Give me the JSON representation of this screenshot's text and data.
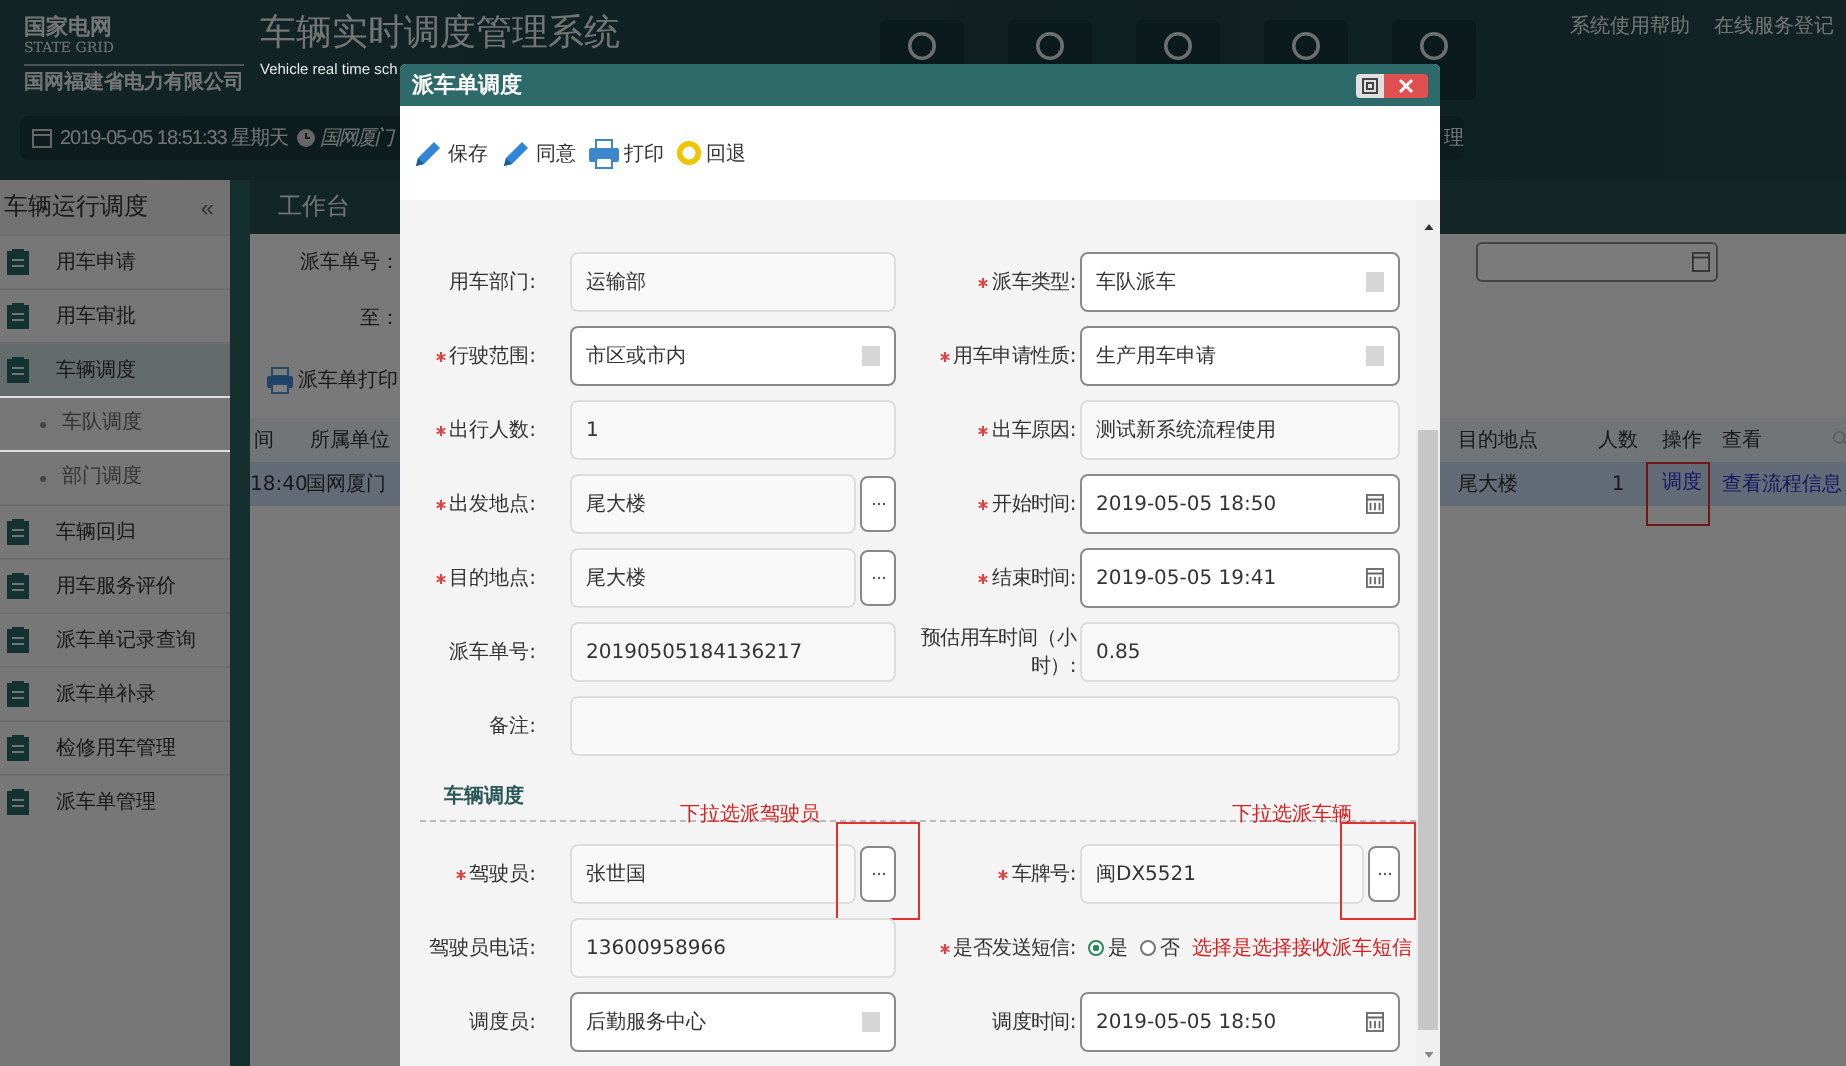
{
  "header": {
    "org_name": "国家电网",
    "org_name_en": "STATE GRID",
    "company": "国网福建省电力有限公司",
    "title": "车辆实时调度管理系统",
    "subtitle": "Vehicle real time sch",
    "datetime": "2019-05-05 18:51:33 星期天",
    "unit": "国网厦门",
    "menu_fragment": "理",
    "links": [
      "系统使用帮助",
      "在线服务登记"
    ]
  },
  "sidebar": {
    "title": "车辆运行调度",
    "collapse": "«",
    "items": [
      {
        "label": "用车申请",
        "selected": false
      },
      {
        "label": "用车审批",
        "selected": false
      },
      {
        "label": "车辆调度",
        "selected": true,
        "children": [
          {
            "label": "车队调度",
            "selected": false
          },
          {
            "label": "部门调度",
            "selected": false
          }
        ]
      },
      {
        "label": "车辆回归",
        "selected": false
      },
      {
        "label": "用车服务评价",
        "selected": false
      },
      {
        "label": "派车单记录查询",
        "selected": false
      },
      {
        "label": "派车单补录",
        "selected": false
      },
      {
        "label": "检修用车管理",
        "selected": false
      },
      {
        "label": "派车单管理",
        "selected": false
      }
    ]
  },
  "workspace": {
    "tab": "工作台",
    "filters": [
      "派车单号：",
      "至："
    ],
    "print_button": "派车单打印",
    "table": {
      "columns": [
        "间",
        "所属单位",
        "目的地点",
        "人数",
        "操作",
        "查看"
      ],
      "rows": [
        {
          "time": "18:40",
          "unit": "国网厦门",
          "destination": "尾大楼",
          "people": "1",
          "action": "调度",
          "action_callout": true,
          "view": "查看流程信息",
          "selected": true
        }
      ]
    }
  },
  "dialog": {
    "title": "派车单调度",
    "toolbar": [
      {
        "kind": "save",
        "label": "保存"
      },
      {
        "kind": "approve",
        "label": "同意"
      },
      {
        "kind": "print",
        "label": "打印"
      },
      {
        "kind": "back",
        "label": "回退"
      }
    ],
    "fields": [
      {
        "label": "用车部门:",
        "required": false,
        "kind": "text",
        "value": "运输部"
      },
      {
        "label": "派车类型:",
        "required": true,
        "kind": "select",
        "value": "车队派车"
      },
      {
        "label": "行驶范围:",
        "required": true,
        "kind": "select",
        "value": "市区或市内"
      },
      {
        "label": "用车申请性质:",
        "required": true,
        "kind": "select",
        "value": "生产用车申请"
      },
      {
        "label": "出行人数:",
        "required": true,
        "kind": "text",
        "value": "1"
      },
      {
        "label": "出车原因:",
        "required": true,
        "kind": "text",
        "value": "测试新系统流程使用"
      },
      {
        "label": "出发地点:",
        "required": true,
        "kind": "picker",
        "value": "尾大楼"
      },
      {
        "label": "开始时间:",
        "required": true,
        "kind": "date",
        "value": "2019-05-05 18:50"
      },
      {
        "label": "目的地点:",
        "required": true,
        "kind": "picker",
        "value": "尾大楼"
      },
      {
        "label": "结束时间:",
        "required": true,
        "kind": "date",
        "value": "2019-05-05 19:41"
      },
      {
        "label": "派车单号:",
        "required": false,
        "kind": "text",
        "value": "20190505184136217"
      },
      {
        "label": "预估用车时间（小时）:",
        "required": false,
        "kind": "text",
        "value": "0.85"
      },
      {
        "label": "备注:",
        "required": false,
        "kind": "textarea"
      }
    ],
    "section": "车辆调度",
    "dispatch_fields": [
      {
        "label": "驾驶员:",
        "required": true,
        "kind": "picker",
        "value": "张世国",
        "note": "下拉选派驾驶员",
        "callout": true
      },
      {
        "label": "车牌号:",
        "required": true,
        "kind": "picker",
        "value": "闽DX5521",
        "note": "下拉选派车辆",
        "callout": true
      },
      {
        "label": "驾驶员电话:",
        "required": false,
        "kind": "text",
        "value": "13600958966"
      },
      {
        "label": "是否发送短信:",
        "required": true,
        "kind": "radio",
        "options": [
          {
            "label": "是",
            "selected": true
          },
          {
            "label": "否",
            "selected": false
          }
        ],
        "note": "选择是选择接收派车短信"
      },
      {
        "label": "调度员:",
        "required": false,
        "kind": "select",
        "value": "后勤服务中心"
      },
      {
        "label": "调度时间:",
        "required": false,
        "kind": "date",
        "value": "2019-05-05 18:50"
      }
    ]
  }
}
